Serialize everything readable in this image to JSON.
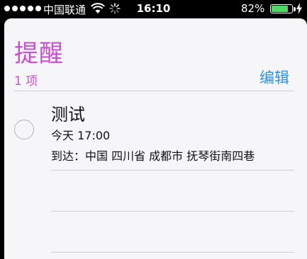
{
  "status_bar": {
    "carrier": "中国联通",
    "time": "16:10",
    "battery_percent": "82%",
    "battery_level": 0.82,
    "icons": [
      "signal-icon",
      "wifi-icon",
      "activity-spinner-icon",
      "battery-icon",
      "charging-icon"
    ]
  },
  "header": {
    "title": "提醒",
    "count": "1 项",
    "edit_label": "编辑"
  },
  "reminders": [
    {
      "title": "测试",
      "time": "今天 17:00",
      "location": "到达：中国 四川省 成都市 抚琴街南四巷"
    }
  ],
  "colors": {
    "accent_purple": "#c94fd2",
    "edit_blue": "#2f90e6",
    "battery_green": "#4cd964",
    "background": "#f6f6f8"
  }
}
